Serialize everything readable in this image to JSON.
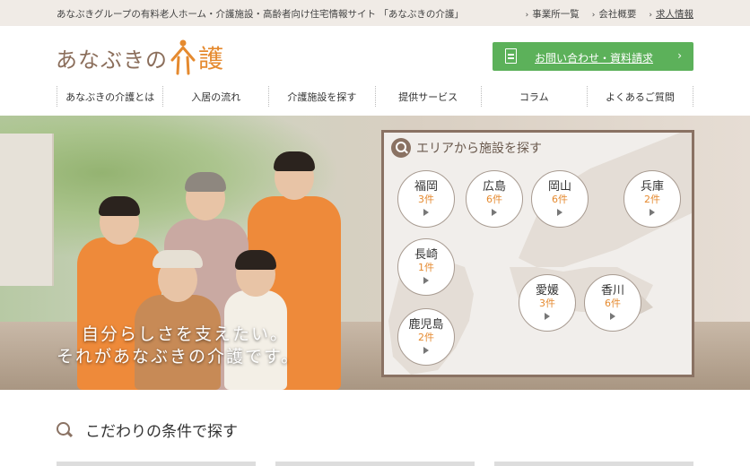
{
  "topbar": {
    "tagline": "あなぶきグループの有料老人ホーム・介護施設・高齢者向け住宅情報サイト 「あなぶきの介護」",
    "links": [
      {
        "label": "事業所一覧"
      },
      {
        "label": "会社概要"
      },
      {
        "label": "求人情報"
      }
    ]
  },
  "header": {
    "logo_text": "あなぶきの",
    "logo_kanji": "護",
    "contact_label": "お問い合わせ・資料請求",
    "contact_arrow": "›"
  },
  "nav": [
    "あなぶきの介護とは",
    "入居の流れ",
    "介護施設を探す",
    "提供サービス",
    "コラム",
    "よくあるご質問"
  ],
  "hero": {
    "catch_line1": "自分らしさを支えたい。",
    "catch_line2": "それがあなぶきの介護です。"
  },
  "area_search": {
    "title": "エリアから施設を探す",
    "prefectures": [
      {
        "name": "福岡",
        "count": "3件"
      },
      {
        "name": "広島",
        "count": "6件"
      },
      {
        "name": "岡山",
        "count": "6件"
      },
      {
        "name": "兵庫",
        "count": "2件"
      },
      {
        "name": "長崎",
        "count": "1件"
      },
      {
        "name": "愛媛",
        "count": "3件"
      },
      {
        "name": "香川",
        "count": "6件"
      },
      {
        "name": "鹿児島",
        "count": "2件"
      }
    ]
  },
  "conditions": {
    "title": "こだわりの条件で探す"
  },
  "colors": {
    "accent_orange": "#e58a2f",
    "brand_brown": "#8a7263",
    "button_green": "#5cb15a"
  }
}
